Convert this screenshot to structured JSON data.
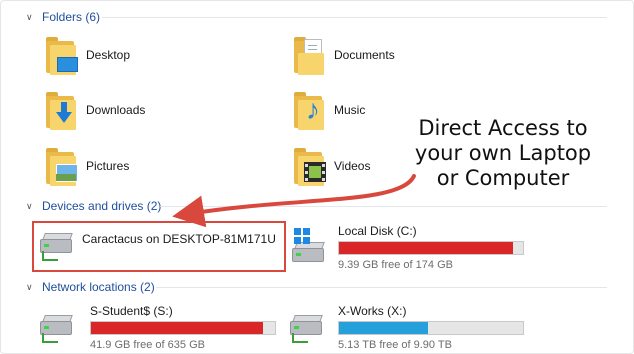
{
  "sections": {
    "folders": {
      "title": "Folders (6)"
    },
    "devices": {
      "title": "Devices and drives (2)"
    },
    "network": {
      "title": "Network locations (2)"
    }
  },
  "folders": [
    {
      "name": "Desktop",
      "icon": "desktop-folder-icon"
    },
    {
      "name": "Documents",
      "icon": "documents-folder-icon"
    },
    {
      "name": "Downloads",
      "icon": "downloads-folder-icon"
    },
    {
      "name": "Music",
      "icon": "music-folder-icon"
    },
    {
      "name": "Pictures",
      "icon": "pictures-folder-icon"
    },
    {
      "name": "Videos",
      "icon": "videos-folder-icon"
    }
  ],
  "devices": [
    {
      "name": "Caractacus on DESKTOP-81M171U",
      "icon": "network-drive-icon"
    },
    {
      "name": "Local Disk (C:)",
      "icon": "windows-drive-icon",
      "free": "9.39 GB free of 174 GB",
      "used_fraction": 0.946,
      "bar_color": "#da2626"
    }
  ],
  "network": [
    {
      "name": "S-Student$ (S:)",
      "icon": "network-drive-icon",
      "free": "41.9 GB free of 635 GB",
      "used_fraction": 0.934,
      "bar_color": "#da2626"
    },
    {
      "name": "X-Works (X:)",
      "icon": "network-drive-icon",
      "free": "5.13 TB free of 9.90 TB",
      "used_fraction": 0.482,
      "bar_color": "#26a0da"
    }
  ],
  "annotation": {
    "lines": [
      "Direct Access to",
      "your own Laptop",
      "or Computer"
    ],
    "arrow_color": "#d9483d",
    "box_color": "#d9483d"
  }
}
